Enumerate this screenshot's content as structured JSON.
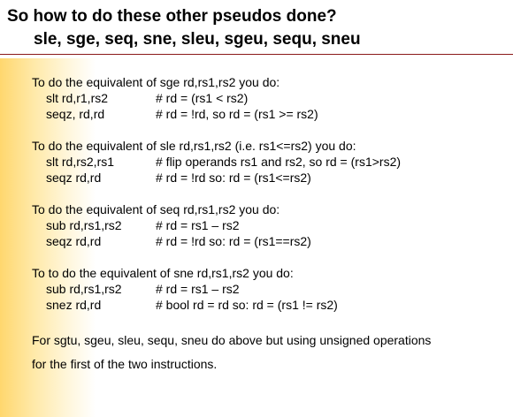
{
  "title": {
    "line1": "So how to do these other pseudos done?",
    "line2": "sle, sge, seq, sne, sleu, sgeu, sequ, sneu"
  },
  "sections": [
    {
      "intro": "To do the equivalent of sge rd,rs1,rs2 you do:",
      "code": [
        {
          "instr": "slt rd,r1,rs2",
          "comment": "# rd = (rs1 < rs2)"
        },
        {
          "instr": "seqz, rd,rd",
          "comment": "# rd = !rd,  so rd = (rs1 >= rs2)"
        }
      ]
    },
    {
      "intro": "To do the equivalent of sle rd,rs1,rs2  (i.e. rs1<=rs2) you do:",
      "code": [
        {
          "instr": "slt rd,rs2,rs1",
          "comment": "# flip operands rs1 and rs2, so rd = (rs1>rs2)"
        },
        {
          "instr": "seqz rd,rd",
          "comment": "# rd = !rd  so: rd = (rs1<=rs2)"
        }
      ]
    },
    {
      "intro": "To do the equivalent of seq rd,rs1,rs2 you do:",
      "code": [
        {
          "instr": "sub rd,rs1,rs2",
          "comment": "# rd = rs1 – rs2"
        },
        {
          "instr": "seqz rd,rd",
          "comment": "# rd = !rd  so: rd = (rs1==rs2)"
        }
      ]
    },
    {
      "intro": "To to do the equivalent of sne rd,rs1,rs2 you do:",
      "code": [
        {
          "instr": "sub rd,rs1,rs2",
          "comment": "# rd = rs1 – rs2"
        },
        {
          "instr": "snez rd,rd",
          "comment": "# bool rd = rd so: rd = (rs1 != rs2)"
        }
      ]
    }
  ],
  "footer": {
    "line1": "For sgtu, sgeu, sleu, sequ, sneu do above but using unsigned operations",
    "line2": "for the first of the two instructions."
  }
}
